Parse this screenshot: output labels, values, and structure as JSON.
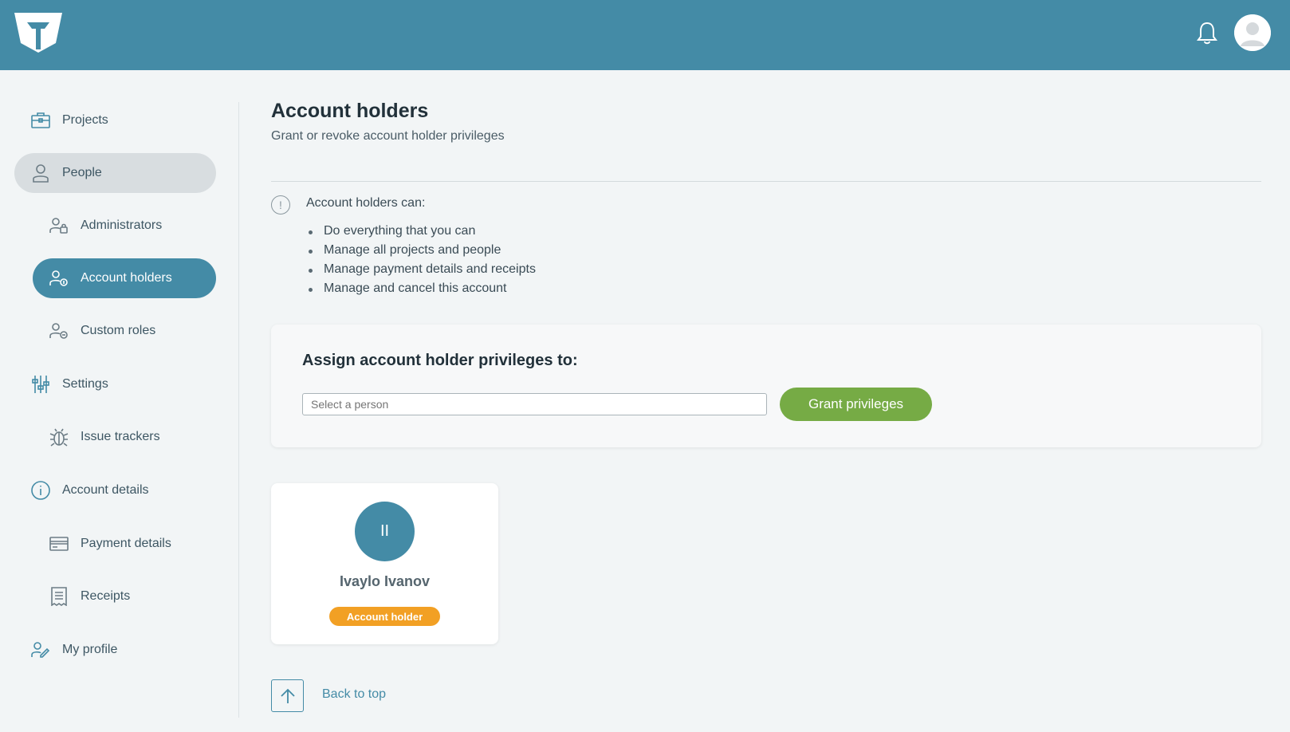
{
  "header": {
    "logo": "app-logo",
    "notifications_icon": "bell-icon",
    "profile_icon": "user-avatar"
  },
  "sidebar": {
    "items": [
      {
        "label": "Projects",
        "icon": "briefcase-icon"
      },
      {
        "label": "People",
        "icon": "person-icon"
      },
      {
        "label": "Administrators",
        "icon": "admin-lock-icon"
      },
      {
        "label": "Account holders",
        "icon": "account-holder-icon"
      },
      {
        "label": "Custom roles",
        "icon": "custom-role-icon"
      },
      {
        "label": "Settings",
        "icon": "sliders-icon"
      },
      {
        "label": "Issue trackers",
        "icon": "bug-icon"
      },
      {
        "label": "Account details",
        "icon": "info-icon"
      },
      {
        "label": "Payment details",
        "icon": "credit-card-icon"
      },
      {
        "label": "Receipts",
        "icon": "receipt-icon"
      },
      {
        "label": "My profile",
        "icon": "edit-profile-icon"
      }
    ]
  },
  "main": {
    "title": "Account holders",
    "subtitle": "Grant or revoke account holder privileges",
    "info": {
      "icon_glyph": "!",
      "heading": "Account holders can:",
      "bullets": [
        "Do everything that you can",
        "Manage all projects and people",
        "Manage payment details and receipts",
        "Manage and cancel this account"
      ]
    },
    "assign": {
      "title": "Assign account holder privileges to:",
      "select_placeholder": "Select a person",
      "button_label": "Grant privileges"
    },
    "people": [
      {
        "initials": "II",
        "name": "Ivaylo Ivanov",
        "badge": "Account holder"
      }
    ],
    "back_to_top": "Back to top"
  },
  "colors": {
    "primary": "#448ba6",
    "grant_button": "#76ab45",
    "badge": "#f2a024"
  }
}
